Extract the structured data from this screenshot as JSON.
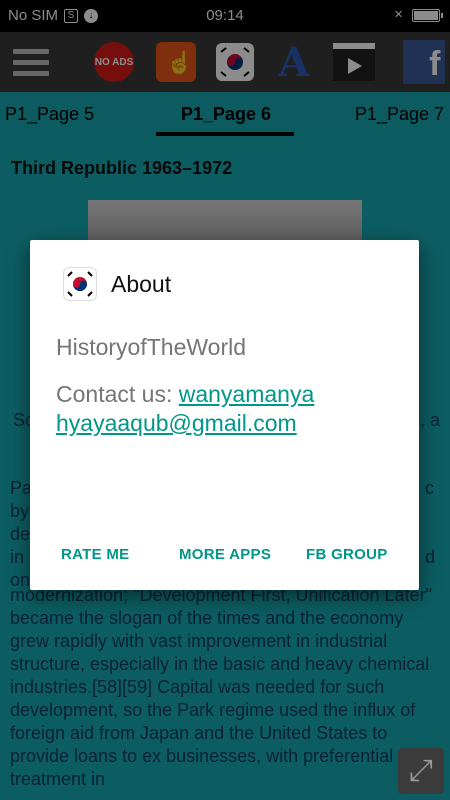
{
  "status_bar": {
    "carrier": "No SIM",
    "time": "09:14"
  },
  "toolbar": {
    "no_ads_label": "NO ADS",
    "font_letter": "A",
    "fb_letter": "f"
  },
  "tabs": {
    "prev": "P1_Page 5",
    "current": "P1_Page 6",
    "next": "P1_Page 7"
  },
  "content": {
    "heading": "Third Republic 1963–1972",
    "partial_left": "So",
    "partial_right": ", a",
    "partial_pa": "Pa",
    "partial_by": "by",
    "partial_de": "de",
    "partial_in": "in",
    "partial_on": "on",
    "partial_c": "c",
    "partial_d": "d",
    "body": "modernization; \"Development First, Unification Later\" became the slogan of the times and the economy grew rapidly with vast improvement in industrial structure, especially in the basic and heavy chemical industries.[58][59] Capital was needed for such development, so the Park regime used the influx of foreign aid from Japan and the United States to provide loans to ex businesses, with preferential treatment in"
  },
  "dialog": {
    "title": "About",
    "app_name": "HistoryofTheWorld",
    "contact_label": "Contact us: ",
    "contact_email": "wanyamanyahyayaaqub@gmail.com",
    "buttons": {
      "rate": "RATE ME",
      "more": "MORE APPS",
      "fb": "FB GROUP"
    }
  }
}
